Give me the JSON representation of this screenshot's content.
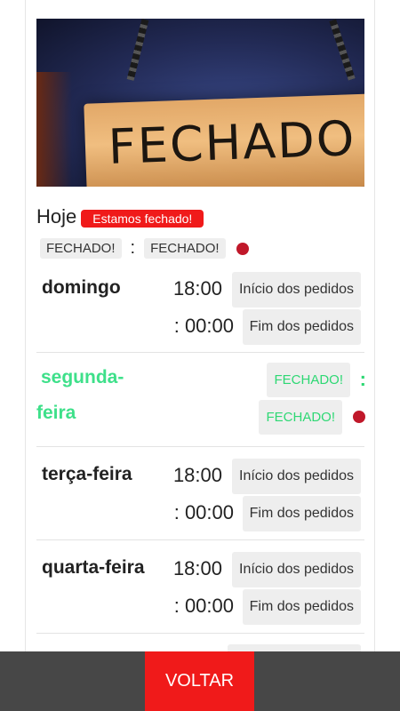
{
  "hero": {
    "sign_text": "FECHADO"
  },
  "today": {
    "label": "Hoje",
    "status_badge": "Estamos fechado!",
    "open_time": "FECHADO!",
    "separator": ":",
    "close_time": "FECHADO!",
    "status_dot_color": "#c0182a"
  },
  "days": [
    {
      "name": "domingo",
      "start_time": "18:00",
      "start_button": "Início dos pedidos",
      "end_time": ": 00:00",
      "end_button": "Fim dos pedidos"
    },
    {
      "name_line1": "segunda-",
      "name_line2": "feira",
      "open": "FECHADO!",
      "separator": ":",
      "close": "FECHADO!",
      "highlight_color": "#2ed874"
    },
    {
      "name": "terça-feira",
      "start_time": "18:00",
      "start_button": "Início dos pedidos",
      "end_time": ": 00:00",
      "end_button": "Fim dos pedidos"
    },
    {
      "name": "quarta-feira",
      "start_time": "18:00",
      "start_button": "Início dos pedidos",
      "end_time": ": 00:00",
      "end_button": "Fim dos pedidos"
    }
  ],
  "footer": {
    "back_label": "VOLTAR",
    "accent_color": "#f01a1a"
  }
}
